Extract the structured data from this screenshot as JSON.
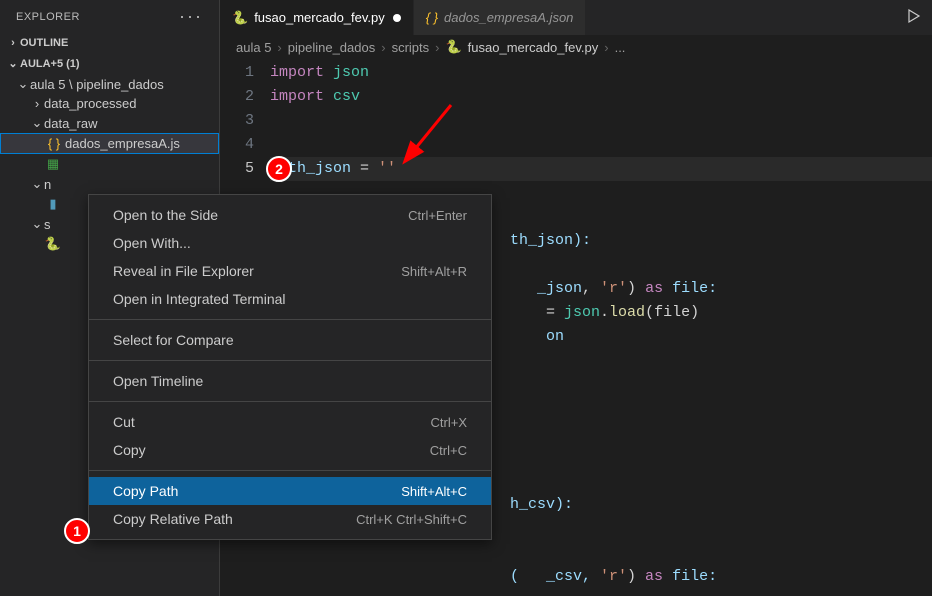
{
  "sidebar": {
    "title": "EXPLORER",
    "sections": {
      "outline": "OUTLINE",
      "workspace": "AULA+5 (1)"
    },
    "tree": {
      "root": "aula 5 \\ pipeline_dados",
      "folders": {
        "data_processed": "data_processed",
        "data_raw": "data_raw",
        "n": "n",
        "s": "s"
      },
      "files": {
        "dados_empresaA": "dados_empresaA.js"
      }
    }
  },
  "tabs": {
    "active": "fusao_mercado_fev.py",
    "inactive": "dados_empresaA.json"
  },
  "breadcrumb": {
    "p1": "aula 5",
    "p2": "pipeline_dados",
    "p3": "scripts",
    "p4": "fusao_mercado_fev.py",
    "p5": "..."
  },
  "code": {
    "line1_kw": "import",
    "line1_mod": "json",
    "line2_kw": "import",
    "line2_mod": "csv",
    "line5_var": "path_json",
    "line5_eq": " = ",
    "line5_str": "''",
    "line7_tail": "th_json):",
    "line8a": "(",
    "line8_var": "   _json",
    "line8b": ", ",
    "line8_str": "'r'",
    "line8c": ") ",
    "line8_kw": "as",
    "line8d": " file:",
    "line9a": "    = ",
    "line9_mod": "json",
    "line9b": ".",
    "line9_func": "load",
    "line9c": "(file)",
    "line10": "    on",
    "line14_tail": "h_csv):",
    "line16a": "(   _csv, ",
    "line16_str": "'r'",
    "line16b": ") ",
    "line16_kw": "as",
    "line16c": " file:"
  },
  "context_menu": {
    "items": [
      {
        "label": "Open to the Side",
        "shortcut": "Ctrl+Enter"
      },
      {
        "label": "Open With...",
        "shortcut": ""
      },
      {
        "label": "Reveal in File Explorer",
        "shortcut": "Shift+Alt+R"
      },
      {
        "label": "Open in Integrated Terminal",
        "shortcut": ""
      }
    ],
    "group2": [
      {
        "label": "Select for Compare",
        "shortcut": ""
      }
    ],
    "group3": [
      {
        "label": "Open Timeline",
        "shortcut": ""
      }
    ],
    "group4": [
      {
        "label": "Cut",
        "shortcut": "Ctrl+X"
      },
      {
        "label": "Copy",
        "shortcut": "Ctrl+C"
      }
    ],
    "group5": [
      {
        "label": "Copy Path",
        "shortcut": "Shift+Alt+C",
        "highlighted": true
      },
      {
        "label": "Copy Relative Path",
        "shortcut": "Ctrl+K Ctrl+Shift+C"
      }
    ]
  },
  "annotations": {
    "a1": "1",
    "a2": "2"
  }
}
